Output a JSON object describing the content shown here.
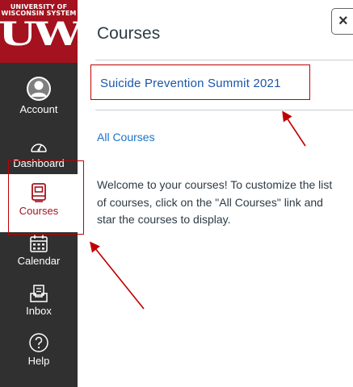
{
  "nav": {
    "logo": {
      "line1": "UNIVERSITY OF",
      "line2": "WISCONSIN SYSTEM",
      "mark": "UW"
    },
    "items": [
      {
        "label": "Account",
        "icon": "account-icon"
      },
      {
        "label": "Dashboard",
        "icon": "dashboard-icon"
      },
      {
        "label": "Courses",
        "icon": "courses-icon",
        "active": true
      },
      {
        "label": "Calendar",
        "icon": "calendar-icon"
      },
      {
        "label": "Inbox",
        "icon": "inbox-icon"
      },
      {
        "label": "Help",
        "icon": "help-icon"
      }
    ]
  },
  "tray": {
    "title": "Courses",
    "close_label": "×",
    "courses": [
      "Suicide Prevention Summit 2021"
    ],
    "all_courses_label": "All Courses",
    "welcome_text": "Welcome to your courses! To customize the list of courses, click on the \"All Courses\" link and star the courses to display."
  },
  "colors": {
    "nav_background": "#303030",
    "brand_red": "#a3121e",
    "link_blue": "#1b73c9",
    "annotation_red": "#c00000"
  }
}
